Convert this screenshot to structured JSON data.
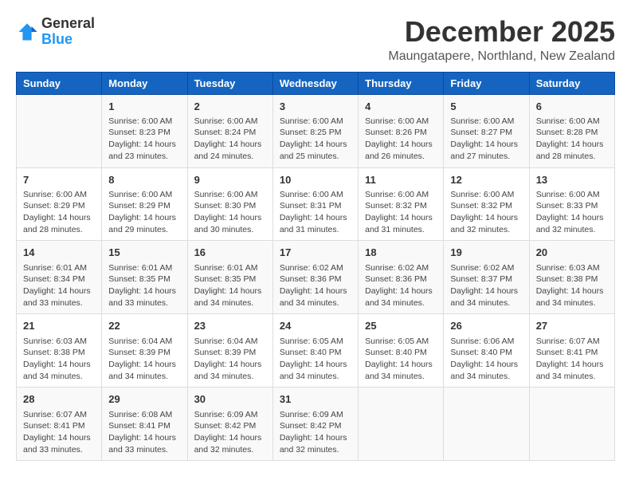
{
  "logo": {
    "line1": "General",
    "line2": "Blue"
  },
  "title": "December 2025",
  "location": "Maungatapere, Northland, New Zealand",
  "headers": [
    "Sunday",
    "Monday",
    "Tuesday",
    "Wednesday",
    "Thursday",
    "Friday",
    "Saturday"
  ],
  "weeks": [
    [
      {
        "num": "",
        "sunrise": "",
        "sunset": "",
        "daylight": ""
      },
      {
        "num": "1",
        "sunrise": "Sunrise: 6:00 AM",
        "sunset": "Sunset: 8:23 PM",
        "daylight": "Daylight: 14 hours and 23 minutes."
      },
      {
        "num": "2",
        "sunrise": "Sunrise: 6:00 AM",
        "sunset": "Sunset: 8:24 PM",
        "daylight": "Daylight: 14 hours and 24 minutes."
      },
      {
        "num": "3",
        "sunrise": "Sunrise: 6:00 AM",
        "sunset": "Sunset: 8:25 PM",
        "daylight": "Daylight: 14 hours and 25 minutes."
      },
      {
        "num": "4",
        "sunrise": "Sunrise: 6:00 AM",
        "sunset": "Sunset: 8:26 PM",
        "daylight": "Daylight: 14 hours and 26 minutes."
      },
      {
        "num": "5",
        "sunrise": "Sunrise: 6:00 AM",
        "sunset": "Sunset: 8:27 PM",
        "daylight": "Daylight: 14 hours and 27 minutes."
      },
      {
        "num": "6",
        "sunrise": "Sunrise: 6:00 AM",
        "sunset": "Sunset: 8:28 PM",
        "daylight": "Daylight: 14 hours and 28 minutes."
      }
    ],
    [
      {
        "num": "7",
        "sunrise": "Sunrise: 6:00 AM",
        "sunset": "Sunset: 8:29 PM",
        "daylight": "Daylight: 14 hours and 28 minutes."
      },
      {
        "num": "8",
        "sunrise": "Sunrise: 6:00 AM",
        "sunset": "Sunset: 8:29 PM",
        "daylight": "Daylight: 14 hours and 29 minutes."
      },
      {
        "num": "9",
        "sunrise": "Sunrise: 6:00 AM",
        "sunset": "Sunset: 8:30 PM",
        "daylight": "Daylight: 14 hours and 30 minutes."
      },
      {
        "num": "10",
        "sunrise": "Sunrise: 6:00 AM",
        "sunset": "Sunset: 8:31 PM",
        "daylight": "Daylight: 14 hours and 31 minutes."
      },
      {
        "num": "11",
        "sunrise": "Sunrise: 6:00 AM",
        "sunset": "Sunset: 8:32 PM",
        "daylight": "Daylight: 14 hours and 31 minutes."
      },
      {
        "num": "12",
        "sunrise": "Sunrise: 6:00 AM",
        "sunset": "Sunset: 8:32 PM",
        "daylight": "Daylight: 14 hours and 32 minutes."
      },
      {
        "num": "13",
        "sunrise": "Sunrise: 6:00 AM",
        "sunset": "Sunset: 8:33 PM",
        "daylight": "Daylight: 14 hours and 32 minutes."
      }
    ],
    [
      {
        "num": "14",
        "sunrise": "Sunrise: 6:01 AM",
        "sunset": "Sunset: 8:34 PM",
        "daylight": "Daylight: 14 hours and 33 minutes."
      },
      {
        "num": "15",
        "sunrise": "Sunrise: 6:01 AM",
        "sunset": "Sunset: 8:35 PM",
        "daylight": "Daylight: 14 hours and 33 minutes."
      },
      {
        "num": "16",
        "sunrise": "Sunrise: 6:01 AM",
        "sunset": "Sunset: 8:35 PM",
        "daylight": "Daylight: 14 hours and 34 minutes."
      },
      {
        "num": "17",
        "sunrise": "Sunrise: 6:02 AM",
        "sunset": "Sunset: 8:36 PM",
        "daylight": "Daylight: 14 hours and 34 minutes."
      },
      {
        "num": "18",
        "sunrise": "Sunrise: 6:02 AM",
        "sunset": "Sunset: 8:36 PM",
        "daylight": "Daylight: 14 hours and 34 minutes."
      },
      {
        "num": "19",
        "sunrise": "Sunrise: 6:02 AM",
        "sunset": "Sunset: 8:37 PM",
        "daylight": "Daylight: 14 hours and 34 minutes."
      },
      {
        "num": "20",
        "sunrise": "Sunrise: 6:03 AM",
        "sunset": "Sunset: 8:38 PM",
        "daylight": "Daylight: 14 hours and 34 minutes."
      }
    ],
    [
      {
        "num": "21",
        "sunrise": "Sunrise: 6:03 AM",
        "sunset": "Sunset: 8:38 PM",
        "daylight": "Daylight: 14 hours and 34 minutes."
      },
      {
        "num": "22",
        "sunrise": "Sunrise: 6:04 AM",
        "sunset": "Sunset: 8:39 PM",
        "daylight": "Daylight: 14 hours and 34 minutes."
      },
      {
        "num": "23",
        "sunrise": "Sunrise: 6:04 AM",
        "sunset": "Sunset: 8:39 PM",
        "daylight": "Daylight: 14 hours and 34 minutes."
      },
      {
        "num": "24",
        "sunrise": "Sunrise: 6:05 AM",
        "sunset": "Sunset: 8:40 PM",
        "daylight": "Daylight: 14 hours and 34 minutes."
      },
      {
        "num": "25",
        "sunrise": "Sunrise: 6:05 AM",
        "sunset": "Sunset: 8:40 PM",
        "daylight": "Daylight: 14 hours and 34 minutes."
      },
      {
        "num": "26",
        "sunrise": "Sunrise: 6:06 AM",
        "sunset": "Sunset: 8:40 PM",
        "daylight": "Daylight: 14 hours and 34 minutes."
      },
      {
        "num": "27",
        "sunrise": "Sunrise: 6:07 AM",
        "sunset": "Sunset: 8:41 PM",
        "daylight": "Daylight: 14 hours and 34 minutes."
      }
    ],
    [
      {
        "num": "28",
        "sunrise": "Sunrise: 6:07 AM",
        "sunset": "Sunset: 8:41 PM",
        "daylight": "Daylight: 14 hours and 33 minutes."
      },
      {
        "num": "29",
        "sunrise": "Sunrise: 6:08 AM",
        "sunset": "Sunset: 8:41 PM",
        "daylight": "Daylight: 14 hours and 33 minutes."
      },
      {
        "num": "30",
        "sunrise": "Sunrise: 6:09 AM",
        "sunset": "Sunset: 8:42 PM",
        "daylight": "Daylight: 14 hours and 32 minutes."
      },
      {
        "num": "31",
        "sunrise": "Sunrise: 6:09 AM",
        "sunset": "Sunset: 8:42 PM",
        "daylight": "Daylight: 14 hours and 32 minutes."
      },
      {
        "num": "",
        "sunrise": "",
        "sunset": "",
        "daylight": ""
      },
      {
        "num": "",
        "sunrise": "",
        "sunset": "",
        "daylight": ""
      },
      {
        "num": "",
        "sunrise": "",
        "sunset": "",
        "daylight": ""
      }
    ]
  ]
}
